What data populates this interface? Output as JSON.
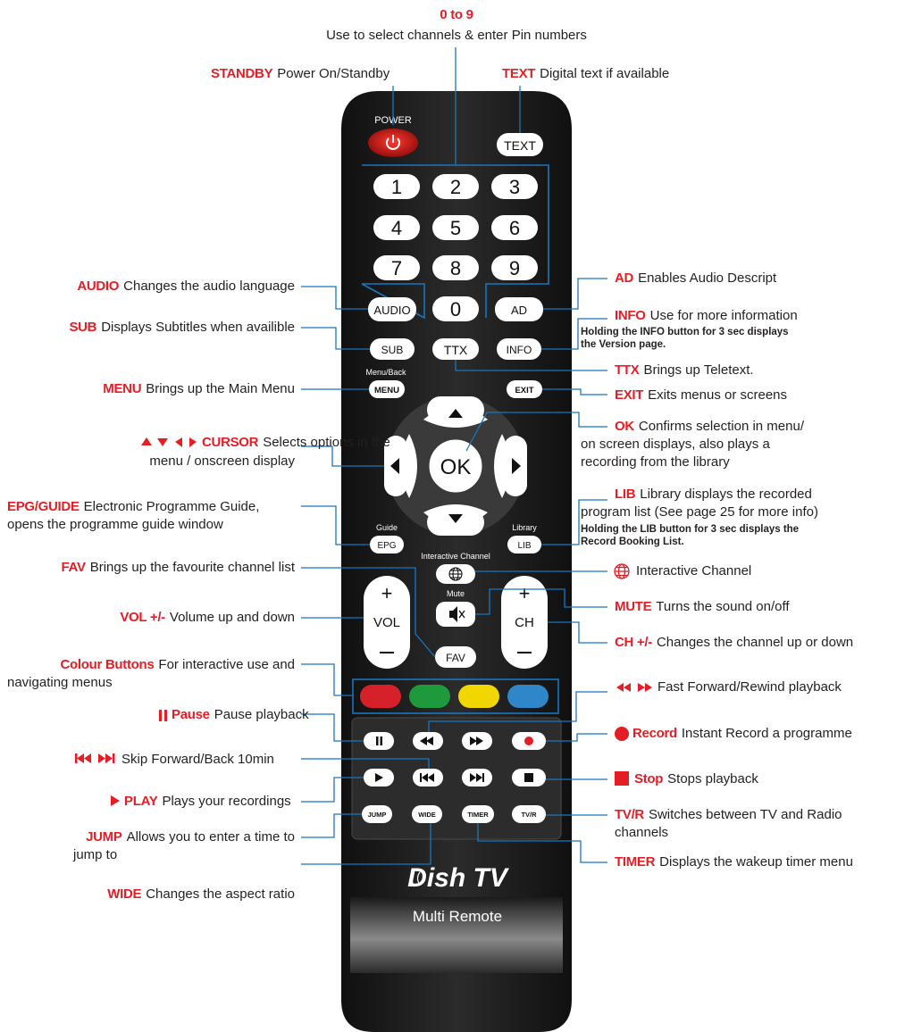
{
  "remote": {
    "power_label": "POWER",
    "text_btn": "TEXT",
    "digits": [
      "1",
      "2",
      "3",
      "4",
      "5",
      "6",
      "7",
      "8",
      "9"
    ],
    "zero": "0",
    "audio_btn": "AUDIO",
    "ad_btn": "AD",
    "sub_btn": "SUB",
    "ttx_btn": "TTX",
    "info_btn": "INFO",
    "menu_caption": "Menu/Back",
    "menu_btn": "MENU",
    "exit_btn": "EXIT",
    "ok_btn": "OK",
    "guide_caption": "Guide",
    "epg_btn": "EPG",
    "library_caption": "Library",
    "lib_btn": "LIB",
    "interactive_caption": "Interactive Channel",
    "mute_caption": "Mute",
    "vol_label": "VOL",
    "ch_label": "CH",
    "fav_btn": "FAV",
    "jump_btn": "JUMP",
    "wide_btn": "WIDE",
    "timer_btn": "TIMER",
    "tvr_btn": "TV/R",
    "brand": "Dish TV",
    "model": "Multi Remote",
    "colour_buttons": [
      "#d6202a",
      "#1e9a3c",
      "#f2d600",
      "#2f86c9"
    ]
  },
  "callouts": {
    "digits": {
      "key": "0 to 9",
      "desc": "Use to select channels & enter Pin numbers"
    },
    "standby": {
      "key": "STANDBY",
      "desc": "Power On/Standby"
    },
    "text": {
      "key": "TEXT",
      "desc": "Digital text if available"
    },
    "audio": {
      "key": "AUDIO",
      "desc": "Changes the audio language"
    },
    "sub": {
      "key": "SUB",
      "desc": "Displays Subtitles when availible"
    },
    "menu": {
      "key": "MENU",
      "desc": "Brings up the Main Menu"
    },
    "cursor": {
      "key": "CURSOR",
      "desc1": "Selects options in the",
      "desc2": "menu / onscreen display"
    },
    "epg": {
      "key": "EPG/GUIDE",
      "desc1": "Electronic Programme Guide,",
      "desc2": "opens the programme guide window"
    },
    "fav": {
      "key": "FAV",
      "desc": "Brings up the favourite channel list"
    },
    "vol": {
      "key": "VOL +/-",
      "desc": "Volume up and down"
    },
    "colour": {
      "key": "Colour Buttons",
      "desc1": "For interactive use and",
      "desc2": "navigating menus"
    },
    "pause": {
      "key": "Pause",
      "desc": "Pause playback"
    },
    "skip": {
      "desc": "Skip Forward/Back 10min"
    },
    "play": {
      "key": "PLAY",
      "desc": "Plays your recordings"
    },
    "jump": {
      "key": "JUMP",
      "desc1": "Allows you to enter a time to",
      "desc2": "jump to"
    },
    "wide": {
      "key": "WIDE",
      "desc": "Changes the aspect ratio"
    },
    "ad": {
      "key": "AD",
      "desc": "Enables Audio Descript"
    },
    "info": {
      "key": "INFO",
      "desc": "Use for more information",
      "note1": "Holding the INFO button for 3 sec displays",
      "note2": "the Version page."
    },
    "ttx": {
      "key": "TTX",
      "desc": "Brings up Teletext."
    },
    "exit": {
      "key": "EXIT",
      "desc": "Exits menus or screens"
    },
    "ok": {
      "key": "OK",
      "desc1": "Confirms selection in menu/",
      "desc2": "on screen displays, also plays a",
      "desc3": "recording from the library"
    },
    "lib": {
      "key": "LIB",
      "desc1": "Library displays the recorded",
      "desc2": "program list (See page 25 for more info)",
      "note1": "Holding the LIB button for 3 sec displays the",
      "note2": "Record Booking List."
    },
    "interactive": {
      "desc": "Interactive Channel"
    },
    "mute": {
      "key": "MUTE",
      "desc": "Turns the sound on/off"
    },
    "ch": {
      "key": "CH +/-",
      "desc": "Changes the channel up or down"
    },
    "ffrw": {
      "desc": "Fast Forward/Rewind playback"
    },
    "record": {
      "key": "Record",
      "desc": "Instant Record a programme"
    },
    "stop": {
      "key": "Stop",
      "desc": "Stops playback"
    },
    "tvr": {
      "key": "TV/R",
      "desc1": "Switches between TV and Radio",
      "desc2": "channels"
    },
    "timer": {
      "key": "TIMER",
      "desc": "Displays the wakeup timer menu"
    }
  },
  "colors": {
    "accent": "#e31e24",
    "body": "#231f20",
    "line": "#1b75bc"
  }
}
